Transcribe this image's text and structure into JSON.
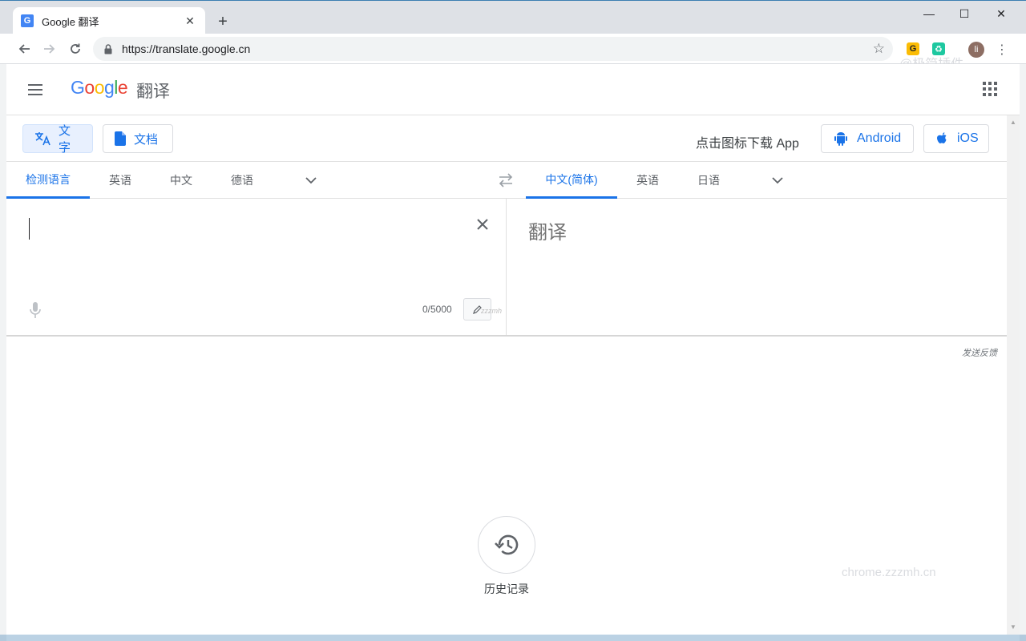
{
  "browser": {
    "tab_title": "Google 翻译",
    "favicon_letter": "G",
    "url": "https://translate.google.cn",
    "extensions": [
      {
        "letter": "G",
        "color": "#fbbc05"
      },
      {
        "letter": "♻",
        "color": "#1ec8a0"
      }
    ],
    "avatar_letter": "li"
  },
  "watermarks": {
    "top": "@极简插件",
    "bottom": "chrome.zzzmh.cn"
  },
  "header": {
    "logo_parts": [
      "G",
      "o",
      "o",
      "g",
      "l",
      "e"
    ],
    "product": "翻译"
  },
  "modes": {
    "text_label": "文字",
    "document_label": "文档",
    "download_text": "点击图标下载 App",
    "android_label": "Android",
    "ios_label": "iOS"
  },
  "source_langs": [
    {
      "label": "检测语言",
      "active": true
    },
    {
      "label": "英语",
      "active": false
    },
    {
      "label": "中文",
      "active": false
    },
    {
      "label": "德语",
      "active": false
    }
  ],
  "target_langs": [
    {
      "label": "中文(简体)",
      "active": true
    },
    {
      "label": "英语",
      "active": false
    },
    {
      "label": "日语",
      "active": false
    }
  ],
  "input": {
    "value": "",
    "char_count": "0/5000",
    "edit_note": "zzzmh"
  },
  "output": {
    "placeholder": "翻译"
  },
  "feedback_label": "发送反馈",
  "history_label": "历史记录",
  "colors": {
    "accent": "#1a73e8",
    "active_mode_bg": "#e8f0fe"
  }
}
